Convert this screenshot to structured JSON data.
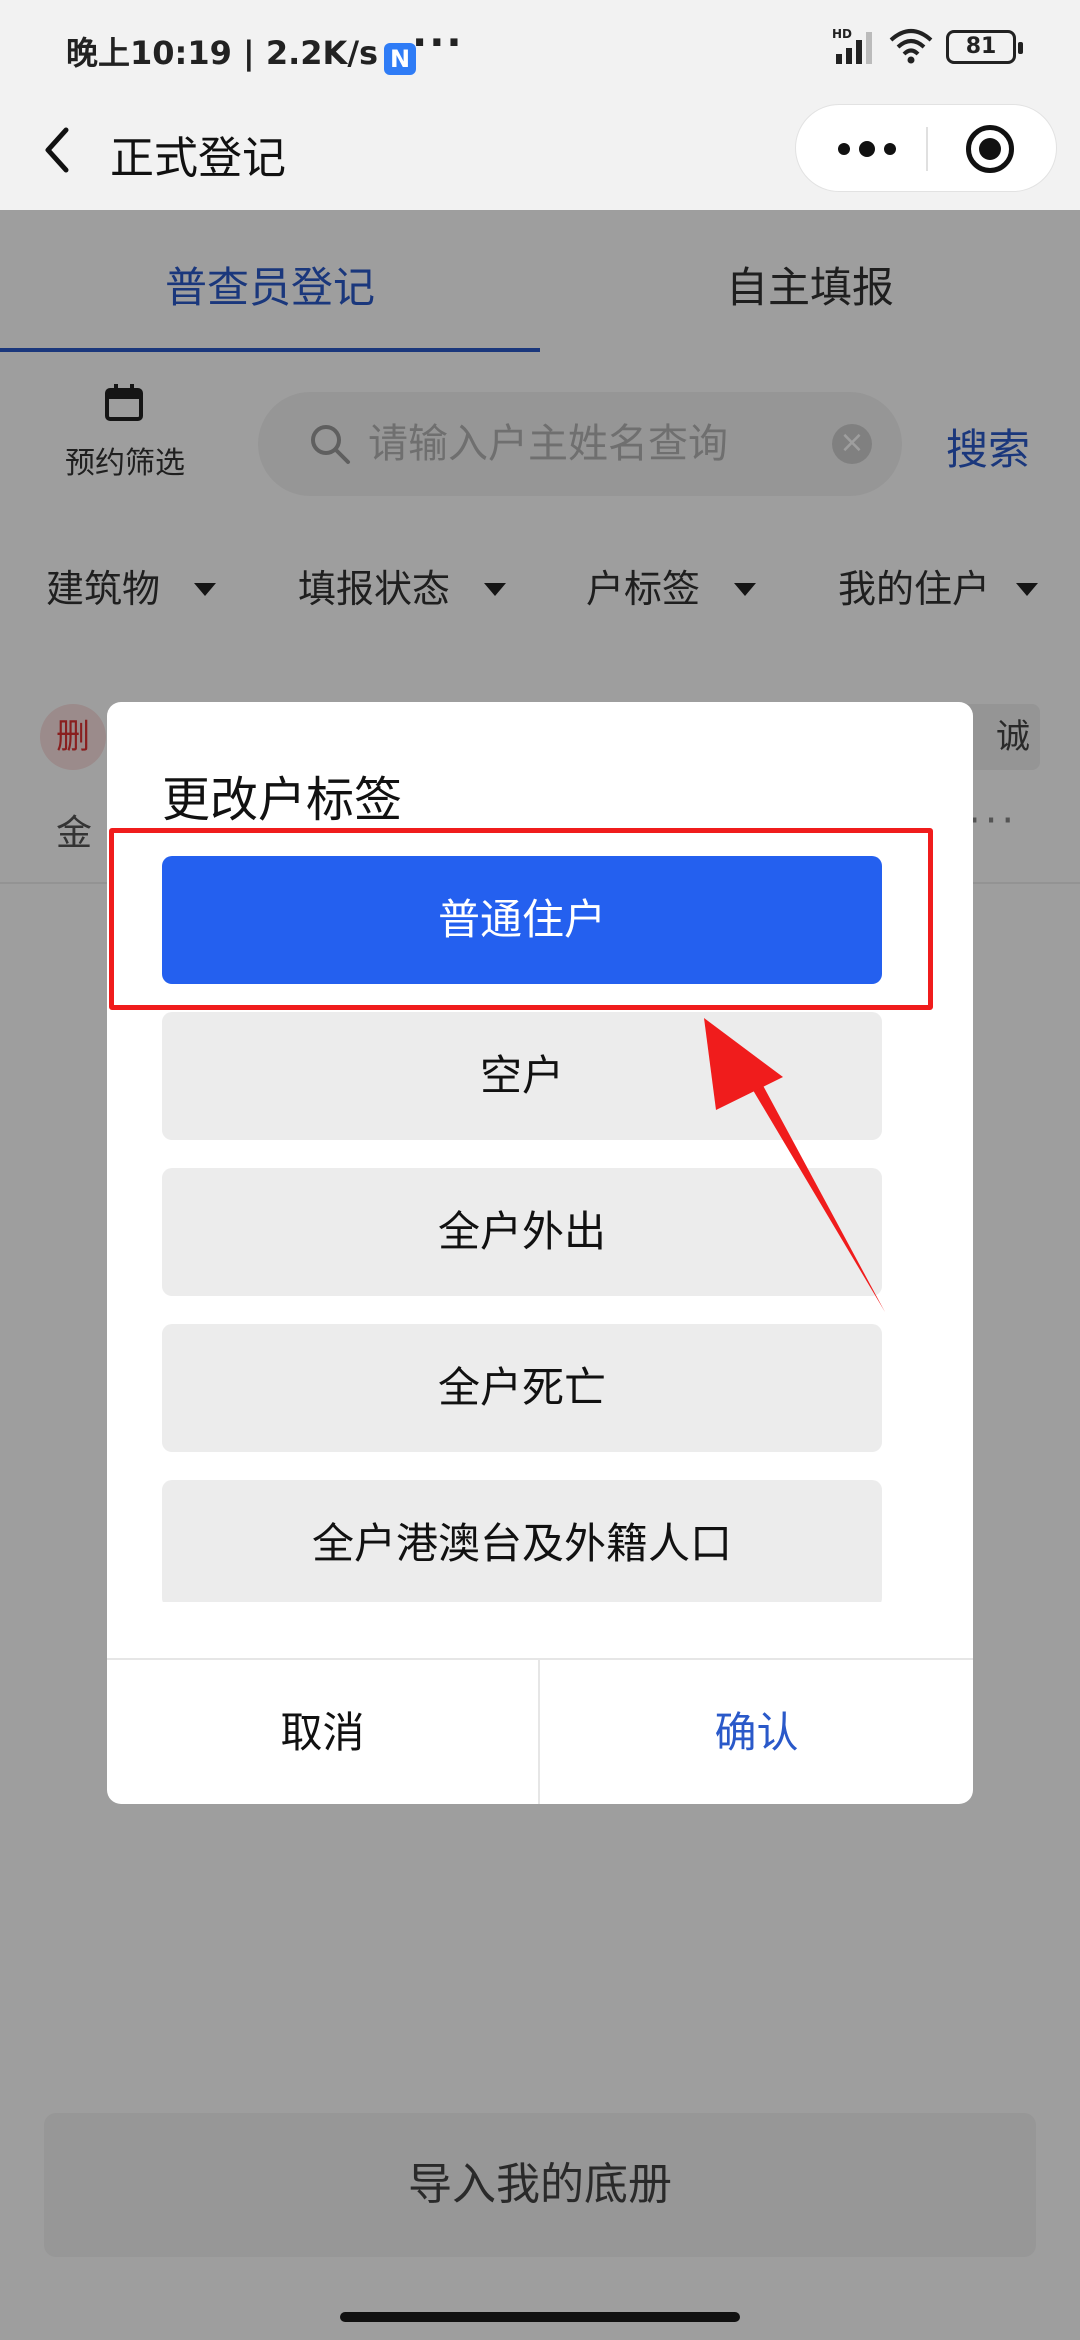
{
  "status_bar": {
    "time": "晚上10:19 | 2.2K/s",
    "app_badge": "N",
    "dots": "···",
    "signal_label": "HD",
    "battery": "81"
  },
  "nav": {
    "title": "正式登记"
  },
  "tabs": {
    "active": "普查员登记",
    "other": "自主填报"
  },
  "toolbar": {
    "filter_label": "预约筛选",
    "search_placeholder": "请输入户主姓名查询",
    "search_button": "搜索"
  },
  "filters": [
    {
      "label": "建筑物"
    },
    {
      "label": "填报状态"
    },
    {
      "label": "户标签"
    },
    {
      "label": "我的住户"
    }
  ],
  "record": {
    "delete_badge": "删",
    "name_prefix": "金",
    "chip_text": "诚",
    "more": "···"
  },
  "dialog": {
    "title": "更改户标签",
    "options": [
      {
        "label": "普通住户",
        "selected": true
      },
      {
        "label": "空户",
        "selected": false
      },
      {
        "label": "全户外出",
        "selected": false
      },
      {
        "label": "全户死亡",
        "selected": false
      },
      {
        "label": "全户港澳台及外籍人口",
        "selected": false
      }
    ],
    "cancel": "取消",
    "confirm": "确认"
  },
  "bottom_button": "导入我的底册",
  "colors": {
    "accent": "#2a59c9",
    "selected_option": "#2460ef",
    "annotation_red": "#f01c1c"
  }
}
